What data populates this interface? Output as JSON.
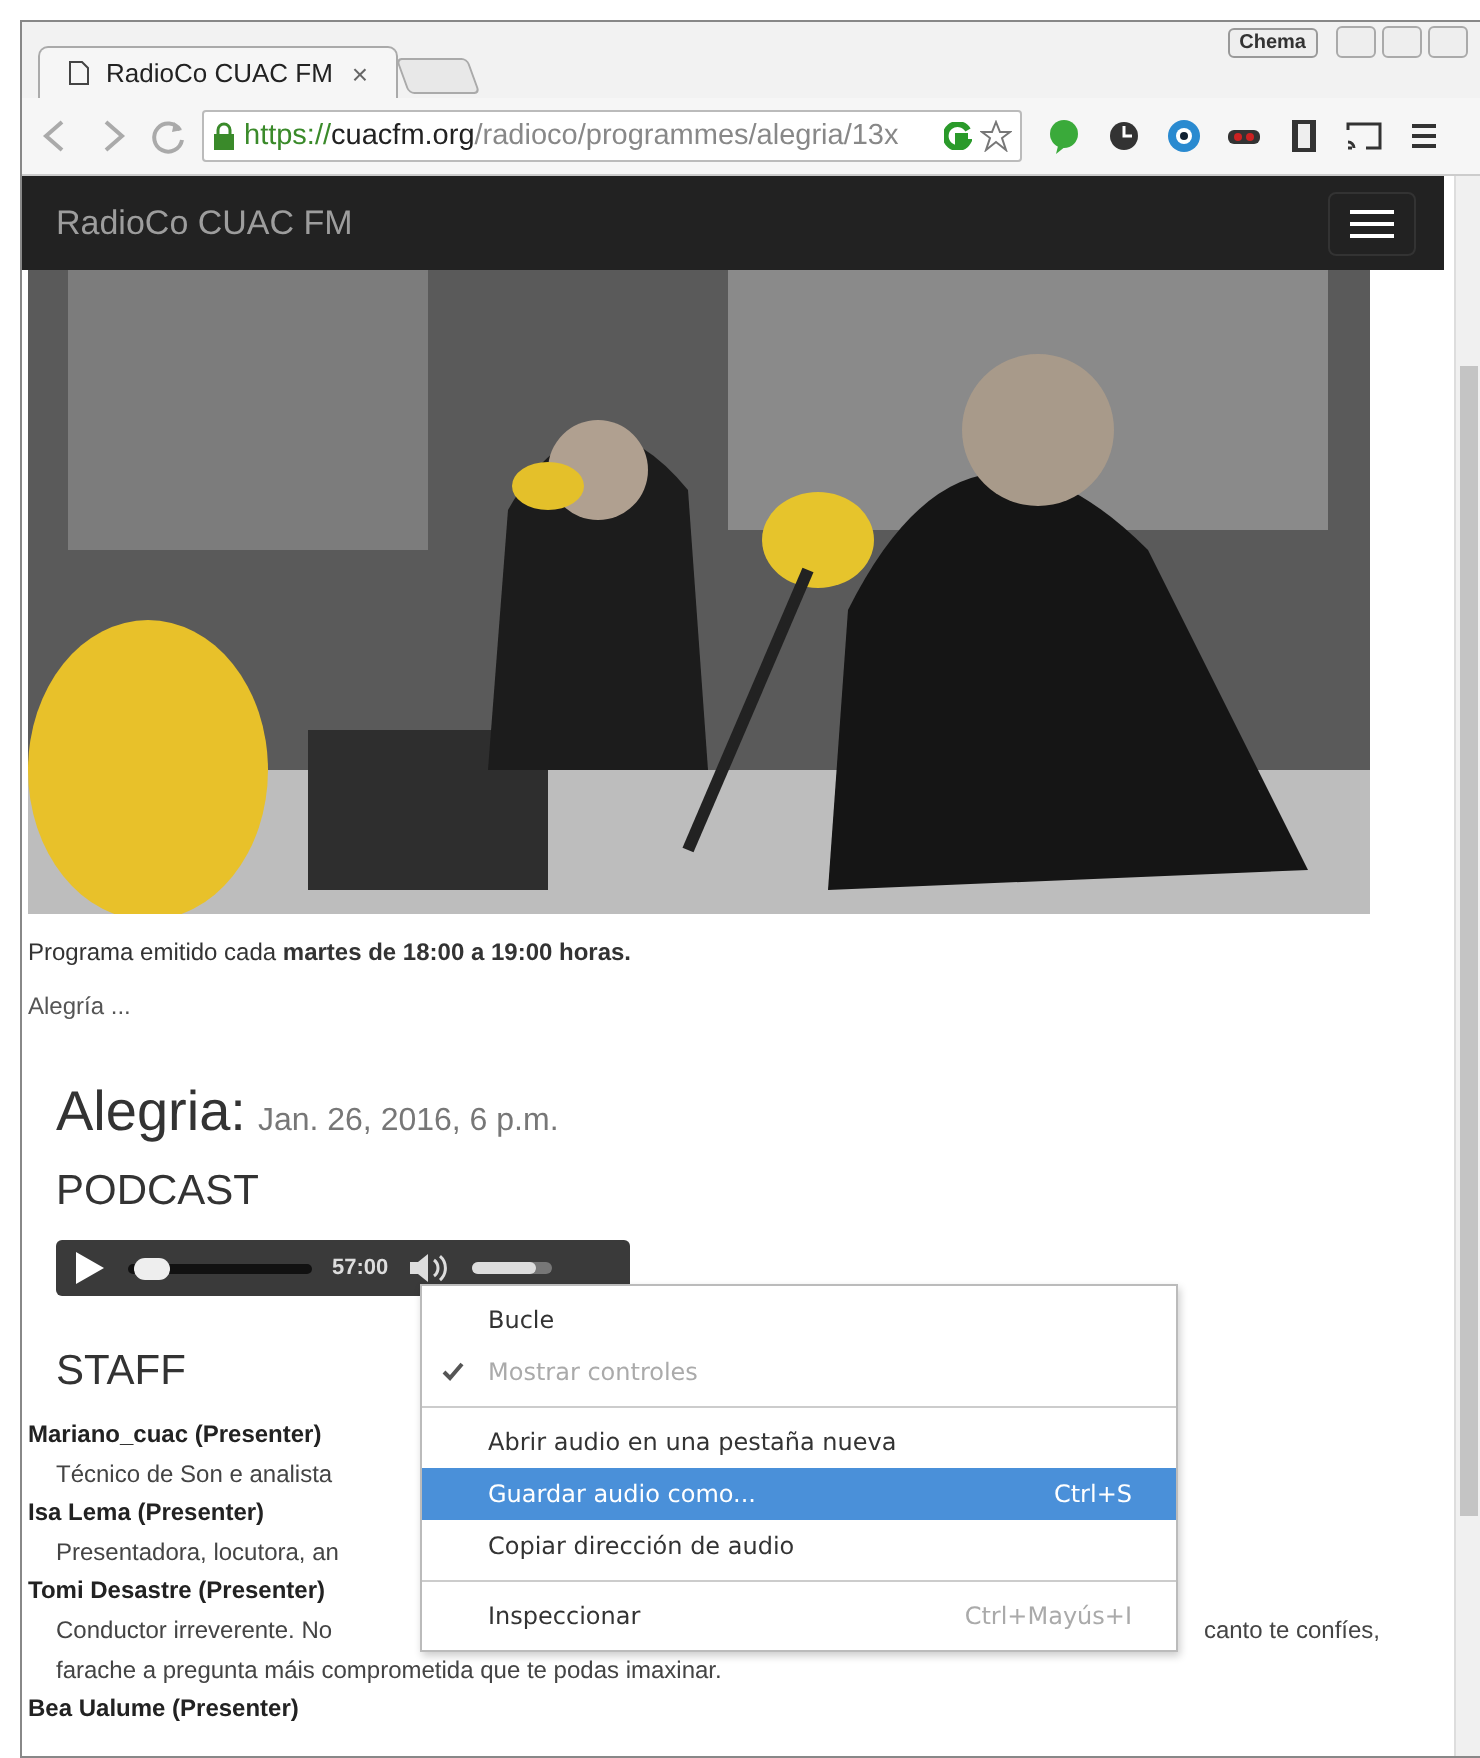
{
  "browser": {
    "profile": "Chema",
    "tabs": [
      {
        "title": "RadioCo CUAC FM",
        "close": "×",
        "selected": true
      }
    ],
    "url": {
      "scheme": "https://",
      "host": "cuacfm.org",
      "path": "/radioco/programmes/alegria/13x"
    }
  },
  "navbar": {
    "brand": "RadioCo CUAC FM"
  },
  "schedule": "Programa emitido cada **martes de 18:00 a 19:00 horas.**",
  "summary": "Alegría ...",
  "episode": {
    "title": "Alegria:",
    "date": "Jan. 26, 2016, 6 p.m."
  },
  "podcast": {
    "heading": "PODCAST",
    "player": {
      "time": "57:00",
      "level": 0.03,
      "volume": {
        "level": 0.8
      }
    }
  },
  "staff": {
    "heading": "STAFF",
    "members": [
      {
        "name": "Mariano_cuac (Presenter)",
        "lines": [
          [
            "Técnico de Son e analista"
          ]
        ]
      },
      {
        "name": "Isa Lema (Presenter)",
        "lines": [
          [
            "Presentadora, locutora, an"
          ]
        ]
      },
      {
        "name": "Tomi Desastre (Presenter)",
        "lines": [
          [
            "Conductor irreverente. No",
            "canto te confíes,"
          ],
          [
            "farache a pregunta máis comprometida que te podas imaxinar."
          ]
        ]
      },
      {
        "name": "Bea Ualume (Presenter)"
      }
    ]
  },
  "context_menu": {
    "items": [
      {
        "kind": "item",
        "label": "Bucle",
        "checked": false,
        "disabled": false,
        "selected": false
      },
      {
        "kind": "item",
        "label": "Mostrar controles",
        "checked": true,
        "disabled": true,
        "selected": false
      },
      {
        "kind": "separator"
      },
      {
        "kind": "item",
        "label": "Abrir audio en una pestaña nueva",
        "checked": false,
        "disabled": false,
        "selected": false
      },
      {
        "kind": "item",
        "label": "Guardar audio como...",
        "shortcut": "Ctrl+S",
        "checked": false,
        "disabled": false,
        "selected": true
      },
      {
        "kind": "item",
        "label": "Copiar dirección de audio",
        "checked": false,
        "disabled": false,
        "selected": false
      },
      {
        "kind": "separator"
      },
      {
        "kind": "item",
        "label": "Inspeccionar",
        "shortcut": "Ctrl+Mayús+I",
        "checked": false,
        "disabled": false,
        "selected": false
      }
    ]
  }
}
